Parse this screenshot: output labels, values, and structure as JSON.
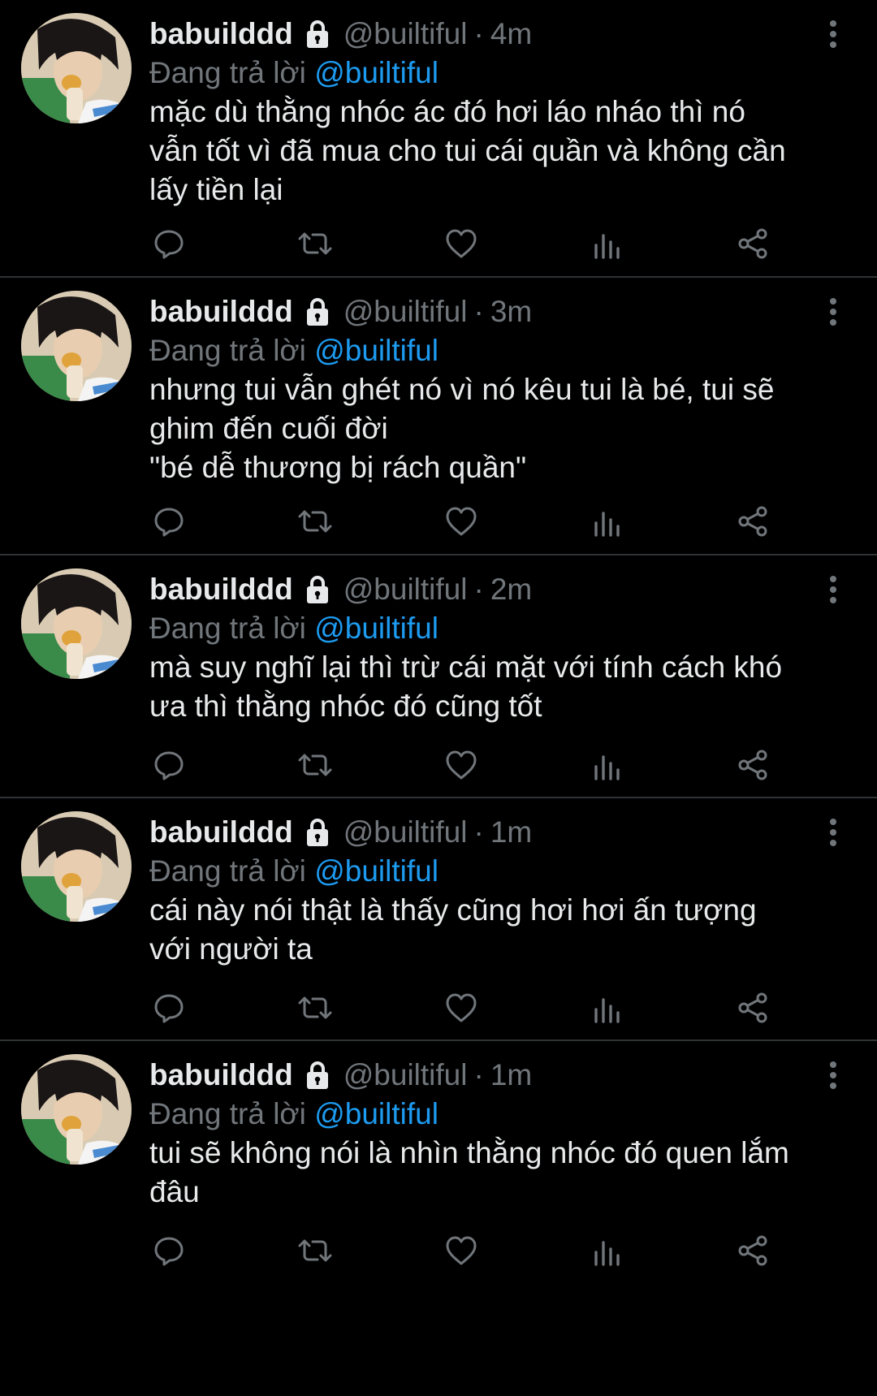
{
  "feed": {
    "tweets": [
      {
        "display_name": "babuilddd",
        "handle": "@builtiful",
        "separator": "·",
        "time": "4m",
        "reply_prefix": "Đang trả lời ",
        "reply_to": "@builtiful",
        "text": "mặc dù thằng nhóc ác đó hơi láo nháo thì nó\nvẫn tốt vì đã mua cho tui cái quần và không cần\nlấy tiền lại"
      },
      {
        "display_name": "babuilddd",
        "handle": "@builtiful",
        "separator": "·",
        "time": "3m",
        "reply_prefix": "Đang trả lời ",
        "reply_to": "@builtiful",
        "text": "nhưng tui vẫn ghét nó vì nó kêu tui là bé, tui sẽ\nghim đến cuối đời\n\"bé dễ thương bị rách quần\""
      },
      {
        "display_name": "babuilddd",
        "handle": "@builtiful",
        "separator": "·",
        "time": "2m",
        "reply_prefix": "Đang trả lời ",
        "reply_to": "@builtiful",
        "text": "mà suy nghĩ lại thì trừ cái mặt với tính cách khó\nưa thì thằng nhóc đó cũng tốt"
      },
      {
        "display_name": "babuilddd",
        "handle": "@builtiful",
        "separator": "·",
        "time": "1m",
        "reply_prefix": "Đang trả lời ",
        "reply_to": "@builtiful",
        "text": "cái này nói thật là thấy cũng hơi hơi ấn tượng\nvới người ta"
      },
      {
        "display_name": "babuilddd",
        "handle": "@builtiful",
        "separator": "·",
        "time": "1m",
        "reply_prefix": "Đang trả lời ",
        "reply_to": "@builtiful",
        "text": "tui sẽ không nói là nhìn thằng nhóc đó quen lắm\nđâu"
      }
    ]
  },
  "icons": {
    "lock": "lock-icon",
    "more": "more-vertical-icon",
    "reply": "reply-icon",
    "retweet": "retweet-icon",
    "like": "like-icon",
    "views": "views-icon",
    "share": "share-icon"
  },
  "colors": {
    "background": "#000000",
    "primary_text": "#e7e9ea",
    "secondary_text": "#71767b",
    "accent": "#1d9bf0",
    "divider": "#2f3336"
  }
}
